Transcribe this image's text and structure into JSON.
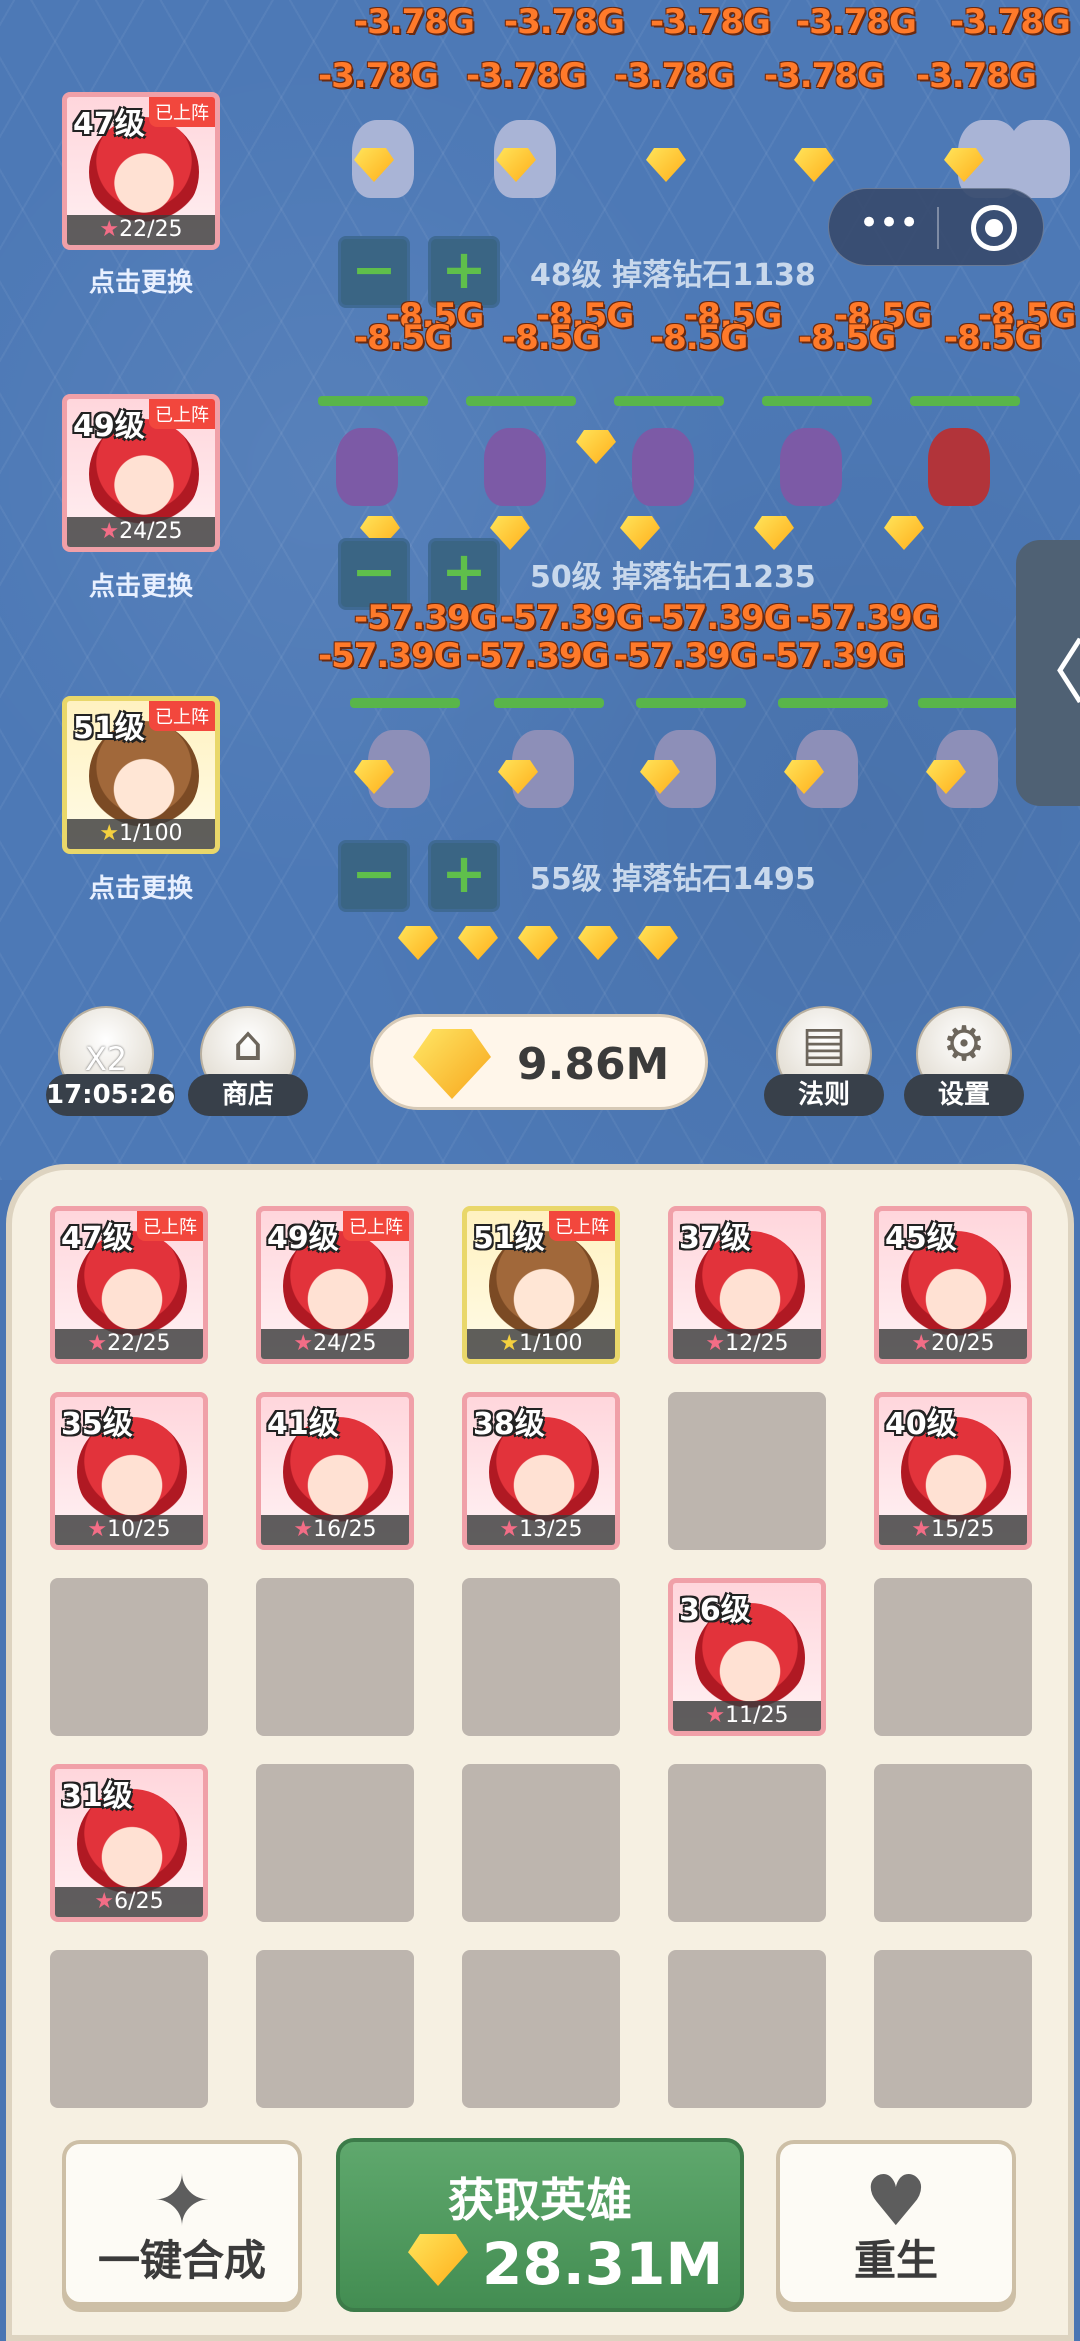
{
  "damage_rows": [
    {
      "text": "-3.78G",
      "row_a": 5,
      "row_b": 5
    },
    {
      "text": "-8.5G",
      "row_a": 5,
      "row_b": 5
    },
    {
      "text": "-57.39G",
      "row_a": 5,
      "row_b": 5
    }
  ],
  "hero_slots": [
    {
      "level": "47级",
      "badge": "已上阵",
      "stars": "22/25",
      "caption": "点击更换",
      "type": "red"
    },
    {
      "level": "49级",
      "badge": "已上阵",
      "stars": "24/25",
      "caption": "点击更换",
      "type": "red"
    },
    {
      "level": "51级",
      "badge": "已上阵",
      "stars": "1/100",
      "caption": "点击更换",
      "type": "gold"
    }
  ],
  "lanes": [
    {
      "info": "48级 掉落钻石1138",
      "minus": "−",
      "plus": "+"
    },
    {
      "info": "50级 掉落钻石1235",
      "minus": "−",
      "plus": "+"
    },
    {
      "info": "55级 掉落钻石1495",
      "minus": "−",
      "plus": "+"
    }
  ],
  "toolbar": {
    "boost": {
      "label": "X2",
      "timer": "17:05:26",
      "icon": "moneybag-icon"
    },
    "shop": {
      "label": "商店",
      "icon": "shop-icon"
    },
    "rules": {
      "label": "法则",
      "icon": "book-icon"
    },
    "settings": {
      "label": "设置",
      "icon": "gear-icon"
    },
    "currency": "9.86M"
  },
  "capsule": {
    "more": "•••",
    "close_icon": "target-icon"
  },
  "side_tab_glyph": "〈",
  "grid": [
    {
      "level": "47级",
      "badge": "已上阵",
      "stars": "22/25",
      "type": "red"
    },
    {
      "level": "49级",
      "badge": "已上阵",
      "stars": "24/25",
      "type": "red"
    },
    {
      "level": "51级",
      "badge": "已上阵",
      "stars": "1/100",
      "type": "gold"
    },
    {
      "level": "37级",
      "badge": "",
      "stars": "12/25",
      "type": "red"
    },
    {
      "level": "45级",
      "badge": "",
      "stars": "20/25",
      "type": "red"
    },
    {
      "level": "35级",
      "badge": "",
      "stars": "10/25",
      "type": "red"
    },
    {
      "level": "41级",
      "badge": "",
      "stars": "16/25",
      "type": "red"
    },
    {
      "level": "38级",
      "badge": "",
      "stars": "13/25",
      "type": "red"
    },
    null,
    {
      "level": "40级",
      "badge": "",
      "stars": "15/25",
      "type": "red"
    },
    null,
    null,
    null,
    {
      "level": "36级",
      "badge": "",
      "stars": "11/25",
      "type": "red"
    },
    null,
    {
      "level": "31级",
      "badge": "",
      "stars": "6/25",
      "type": "red"
    },
    null,
    null,
    null,
    null,
    null,
    null,
    null,
    null,
    null
  ],
  "actions": {
    "merge": {
      "label": "一键合成",
      "icon": "sparkle-icon"
    },
    "get_hero": {
      "label": "获取英雄",
      "cost": "28.31M"
    },
    "rebirth": {
      "label": "重生",
      "icon": "hands-heart-icon"
    }
  },
  "colors": {
    "background": "#4d79b6",
    "damage": "#ff7a2a",
    "green_button": "#4f9a5e",
    "panel": "#f6f0e2"
  }
}
